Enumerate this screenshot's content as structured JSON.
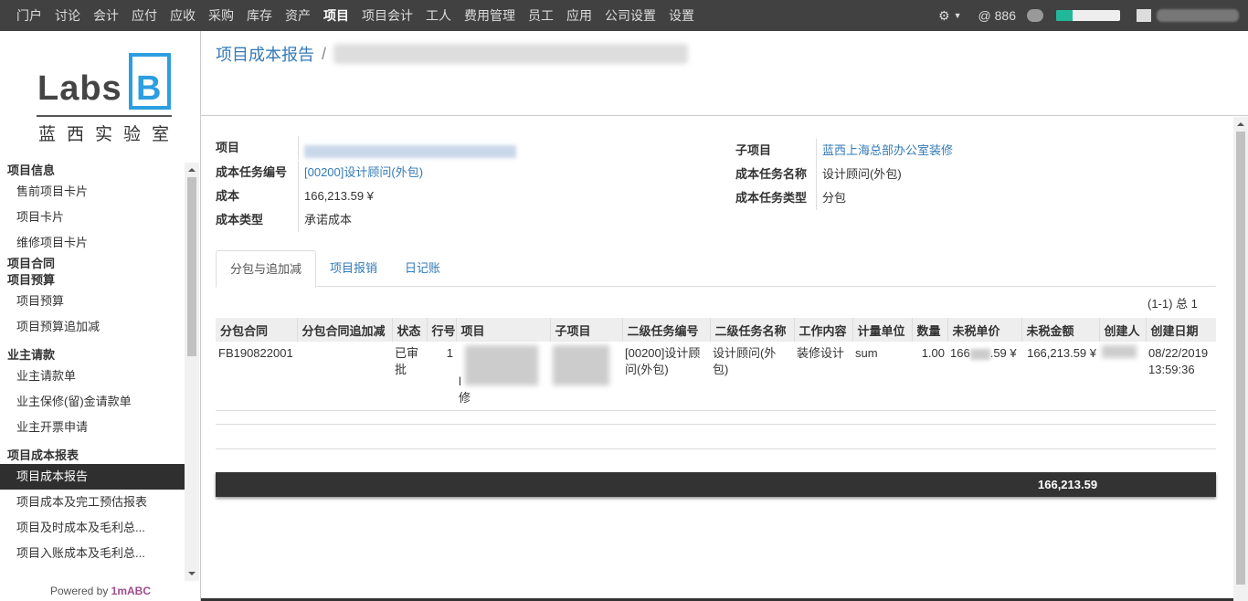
{
  "topbar": {
    "menu": [
      "门户",
      "讨论",
      "会计",
      "应付",
      "应收",
      "采购",
      "库存",
      "资产",
      "项目",
      "项目会计",
      "工人",
      "费用管理",
      "员工",
      "应用",
      "公司设置",
      "设置"
    ],
    "active_index": 8,
    "mentions": "@ 886",
    "progress_fraction": 0.25
  },
  "logo": {
    "word": "Labs",
    "letter": "B",
    "cn": "蓝西实验室"
  },
  "sidebar": {
    "sections": [
      {
        "title": "项目信息",
        "items": [
          "售前项目卡片",
          "项目卡片",
          "维修项目卡片"
        ]
      },
      {
        "title": "项目合同",
        "items": []
      },
      {
        "title": "项目预算",
        "items": [
          "项目预算",
          "项目预算追加减"
        ]
      },
      {
        "title": "业主请款",
        "items": [
          "业主请款单",
          "业主保修(留)金请款单",
          "业主开票申请"
        ]
      },
      {
        "title": "项目成本报表",
        "items": [
          "项目成本报告",
          "项目成本及完工预估报表",
          "项目及时成本及毛利总...",
          "项目入账成本及毛利总..."
        ]
      }
    ],
    "active_item": "项目成本报告",
    "powered_by": "Powered by ",
    "powered_brand": "1mABC"
  },
  "breadcrumb": {
    "root": "项目成本报告",
    "sep": "/"
  },
  "form": {
    "project_label": "项目",
    "cost_task_no_label": "成本任务编号",
    "cost_task_no": "[00200]设计顾问(外包)",
    "cost_label": "成本",
    "cost": "166,213.59 ¥",
    "cost_type_label": "成本类型",
    "cost_type": "承诺成本",
    "sub_project_label": "子项目",
    "sub_project": "蓝西上海总部办公室装修",
    "cost_task_name_label": "成本任务名称",
    "cost_task_name": "设计顾问(外包)",
    "cost_task_type_label": "成本任务类型",
    "cost_task_type": "分包"
  },
  "tabs": [
    "分包与追加减",
    "项目报销",
    "日记账"
  ],
  "pager": "(1-1) 总 1",
  "table": {
    "headers": [
      "分包合同",
      "分包合同追加减",
      "状态",
      "行号",
      "项目",
      "子项目",
      "二级任务编号",
      "二级任务名称",
      "工作内容",
      "计量单位",
      "数量",
      "未税单价",
      "未税金额",
      "创建人",
      "创建日期"
    ],
    "row": {
      "contract": "FB190822001",
      "contract_adj": "",
      "status": "已审批",
      "line": "1",
      "project_suffix": "l",
      "project_tail": "修",
      "task_no": "[00200]设计顾问(外包)",
      "task_name": "设计顾问(外包)",
      "work": "装修设计",
      "unit": "sum",
      "qty": "1.00",
      "unit_price_prefix": "166",
      "unit_price_suffix": ".59 ¥",
      "amount": "166,213.59 ¥",
      "created_date": "08/22/2019 13:59:36"
    },
    "total": "166,213.59"
  }
}
